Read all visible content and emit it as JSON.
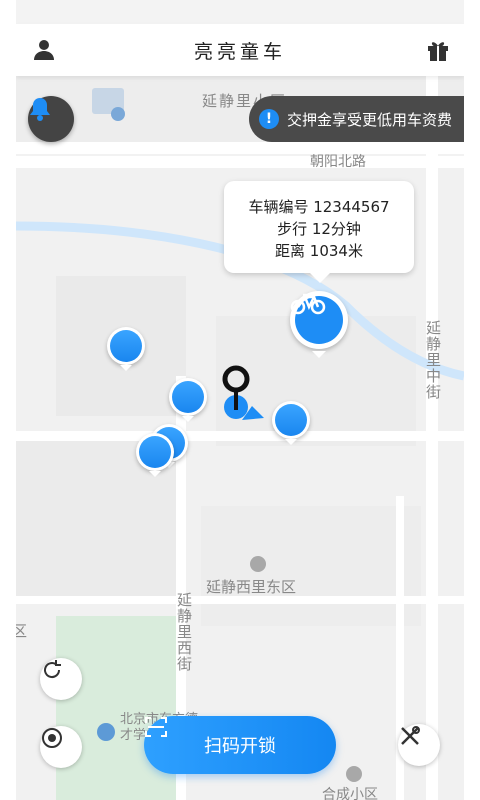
{
  "header": {
    "title": "亮亮童车",
    "user_icon": "user-icon",
    "gift_icon": "gift-icon"
  },
  "promo": {
    "text": "交押金享受更低用车资费",
    "icon": "info-icon"
  },
  "tooltip": {
    "line1": "车辆编号 12344567",
    "line2": "步行 12分钟",
    "line3": "距离 1034米"
  },
  "map_labels": {
    "yanjing_li": "延静里小区",
    "chaoyang_north_road": "朝阳北路",
    "yanjing_middle_street": "延静里中街",
    "yanjing_west_east": "延静西里东区",
    "yanjing_west_street": "延静里西街",
    "district_edge": "区",
    "school": "北京市东方德才学校",
    "hecheng": "合成小区"
  },
  "bottom": {
    "scan_label": "扫码开锁"
  },
  "colors": {
    "accent": "#1e8df5",
    "toast_bg": "#4a4a4a"
  }
}
